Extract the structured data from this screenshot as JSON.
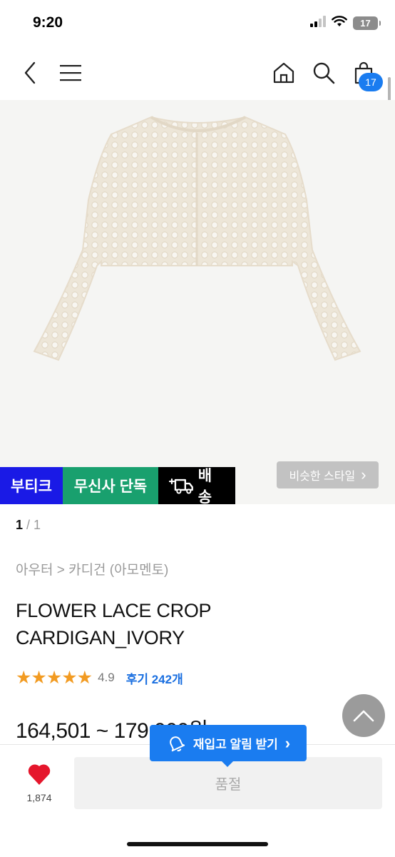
{
  "status_bar": {
    "time": "9:20",
    "battery": "17"
  },
  "nav": {
    "cart_count": "17"
  },
  "badges": {
    "boutique": "부티크",
    "exclusive": "무신사 단독",
    "delivery": "배송"
  },
  "similar_style": {
    "label": "비슷한 스타일",
    "arrow": "›"
  },
  "pager": {
    "current": "1",
    "total": "/ 1"
  },
  "breadcrumb": "아우터 > 카디건 (아모멘토)",
  "product": {
    "name_line1": "FLOWER LACE CROP",
    "name_line2": "CARDIGAN_IVORY",
    "stars": "★★★★★",
    "rating": "4.9",
    "reviews": "후기 242개",
    "price": "164,501 ~ 179,000원"
  },
  "restock": {
    "label": "재입고 알림 받기",
    "arrow": "›"
  },
  "bottom": {
    "like_count": "1,874",
    "soldout": "품절"
  },
  "colors": {
    "accent": "#1a7cf0",
    "boutique": "#1a1ae6",
    "exclusive": "#19a06e",
    "star": "#f29b22",
    "heart": "#e5162c"
  },
  "icons": [
    "back-icon",
    "menu-icon",
    "home-icon",
    "search-icon",
    "cart-icon",
    "truck-icon",
    "bell-icon",
    "heart-icon",
    "chevron-up-icon"
  ]
}
